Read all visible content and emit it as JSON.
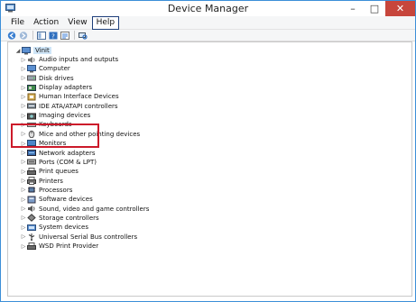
{
  "window": {
    "title": "Device Manager",
    "controls": {
      "minimize": "–",
      "maximize": "□",
      "close": "✕"
    }
  },
  "menu": {
    "items": [
      {
        "label": "File"
      },
      {
        "label": "Action"
      },
      {
        "label": "View"
      },
      {
        "label": "Help"
      }
    ]
  },
  "toolbar": {
    "buttons": [
      "back-icon",
      "forward-icon",
      "console-tree-icon",
      "help-icon",
      "properties-icon",
      "scan-hardware-icon"
    ]
  },
  "tree": {
    "root": {
      "label": "Vinit",
      "expanded": true
    },
    "items": [
      {
        "label": "Audio inputs and outputs",
        "icon": "speaker-icon"
      },
      {
        "label": "Computer",
        "icon": "computer-icon"
      },
      {
        "label": "Disk drives",
        "icon": "disk-drive-icon"
      },
      {
        "label": "Display adapters",
        "icon": "display-adapter-icon"
      },
      {
        "label": "Human Interface Devices",
        "icon": "hid-icon"
      },
      {
        "label": "IDE ATA/ATAPI controllers",
        "icon": "ide-controller-icon"
      },
      {
        "label": "Imaging devices",
        "icon": "camera-icon"
      },
      {
        "label": "Keyboards",
        "icon": "keyboard-icon"
      },
      {
        "label": "Mice and other pointing devices",
        "icon": "mouse-icon"
      },
      {
        "label": "Monitors",
        "icon": "monitor-icon"
      },
      {
        "label": "Network adapters",
        "icon": "network-adapter-icon"
      },
      {
        "label": "Ports (COM & LPT)",
        "icon": "port-icon"
      },
      {
        "label": "Print queues",
        "icon": "print-queue-icon"
      },
      {
        "label": "Printers",
        "icon": "printer-icon"
      },
      {
        "label": "Processors",
        "icon": "processor-icon"
      },
      {
        "label": "Software devices",
        "icon": "software-device-icon"
      },
      {
        "label": "Sound, video and game controllers",
        "icon": "sound-icon"
      },
      {
        "label": "Storage controllers",
        "icon": "storage-controller-icon"
      },
      {
        "label": "System devices",
        "icon": "system-device-icon"
      },
      {
        "label": "Universal Serial Bus controllers",
        "icon": "usb-icon"
      },
      {
        "label": "WSD Print Provider",
        "icon": "wsd-printer-icon"
      }
    ]
  },
  "colors": {
    "accent_border": "#3c8fd8",
    "close_button": "#c7463c",
    "selection": "#cfe5f7",
    "highlight_box": "#cc1a2a"
  }
}
